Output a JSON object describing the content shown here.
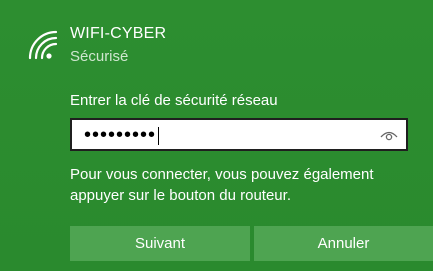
{
  "network": {
    "name": "WIFI-CYBER",
    "status": "Sécurisé",
    "icon": "wifi-secured-icon"
  },
  "password": {
    "label": "Entrer la clé de sécurité réseau",
    "masked_value": "•••••••••",
    "reveal_icon": "eye-icon"
  },
  "hint": "Pour vous connecter, vous pouvez également appuyer sur le bouton du routeur.",
  "buttons": {
    "next": "Suivant",
    "cancel": "Annuler"
  },
  "colors": {
    "background": "#2b8a2f",
    "button": "#4ea451"
  }
}
